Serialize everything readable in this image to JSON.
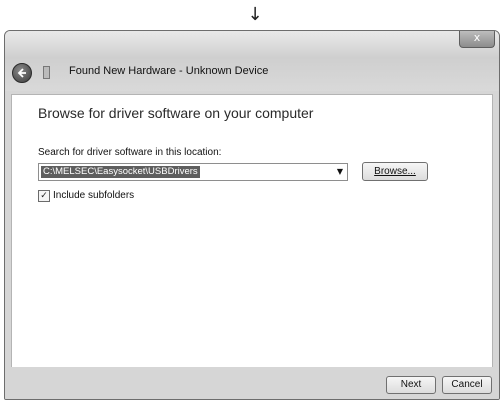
{
  "indicator": {
    "arrow": "↓"
  },
  "window": {
    "title": "Found New Hardware - Unknown Device",
    "close_label": "x",
    "icons": {
      "back": "back-arrow-icon",
      "wizard": "hardware-wizard-icon"
    }
  },
  "main": {
    "heading": "Browse for driver software on your computer",
    "search_label": "Search for driver software in this location:",
    "path_value": "C:\\MELSEC\\Easysocket\\USBDrivers",
    "browse_label": "Browse...",
    "include_subfolders": {
      "label": "Include subfolders",
      "checked": true
    }
  },
  "footer": {
    "next_label": "Next",
    "cancel_label": "Cancel"
  },
  "colors": {
    "selection": "#5e5e5e",
    "chrome": "#d6d6d6"
  }
}
